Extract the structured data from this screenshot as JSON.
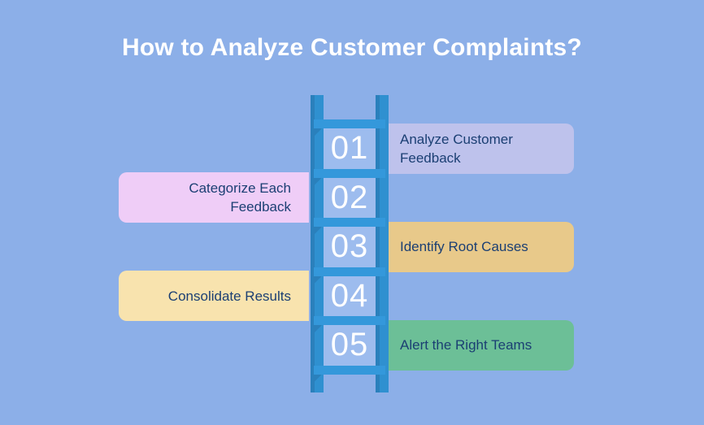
{
  "title": "How to Analyze Customer Complaints?",
  "colors": {
    "background": "#8CAFE8",
    "title_text": "#FFFFFF",
    "label_text": "#1B3F73",
    "ladder_rail": "#2F90D0",
    "ladder_rung": "#3498DB",
    "step_panel": "#9DBCEE",
    "step_number_text": "#FFFFFF"
  },
  "steps": [
    {
      "number": "01",
      "label": "Analyze Customer Feedback",
      "side": "right",
      "color": "#BEC2EC"
    },
    {
      "number": "02",
      "label": "Categorize Each Feedback",
      "side": "left",
      "color": "#EFCDF7"
    },
    {
      "number": "03",
      "label": "Identify Root Causes",
      "side": "right",
      "color": "#E8C98A"
    },
    {
      "number": "04",
      "label": "Consolidate Results",
      "side": "left",
      "color": "#F8E3AE"
    },
    {
      "number": "05",
      "label": "Alert the Right Teams",
      "side": "right",
      "color": "#6CBF97"
    }
  ]
}
